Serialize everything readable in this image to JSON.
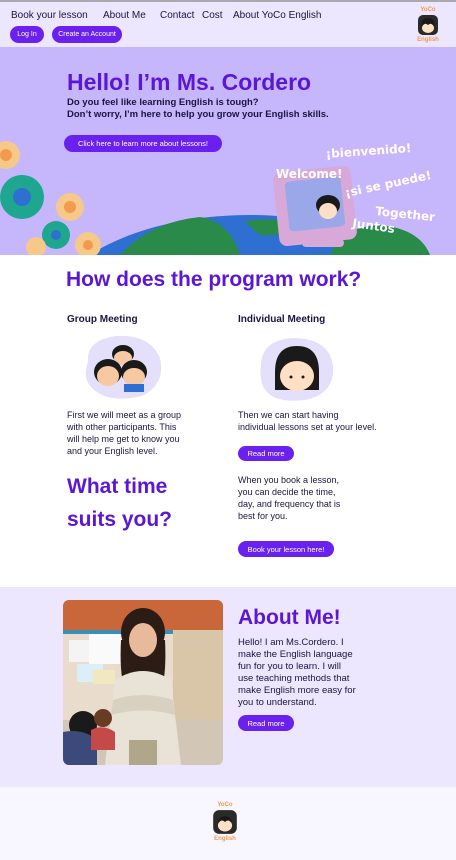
{
  "nav": {
    "links": [
      "Book your lesson",
      "About Me",
      "Contact",
      "Cost",
      "About YoCo English"
    ],
    "login_label": "Log In",
    "create_account_label": "Create an Account"
  },
  "logo": {
    "top": "YoCo",
    "bottom": "English"
  },
  "hero": {
    "title": "Hello! I’m Ms. Cordero",
    "subtitle_line1": "Do you feel like learning English is tough?",
    "subtitle_line2": "Don’t worry, I’m here to help you grow your English skills.",
    "cta_label": "Click here to learn more about lessons!",
    "bubbles": [
      "¡bienvenido!",
      "Welcome!",
      "¡si se puede!",
      "Together",
      "Juntos"
    ]
  },
  "program": {
    "title": "How does the program work?",
    "group": {
      "heading": "Group Meeting",
      "text": [
        "First we will meet as a group",
        "with other participants. This",
        "will help me get to know you",
        "and your English level."
      ]
    },
    "individual": {
      "heading": "Individual Meeting",
      "text": [
        "Then we can start having",
        "individual lessons set at your level."
      ],
      "read_more_label": "Read more"
    }
  },
  "time": {
    "title_line1": "What time",
    "title_line2": "suits you?",
    "text": [
      "When you book a lesson,",
      "you can decide the time,",
      "day, and frequency that is",
      "best for you."
    ],
    "book_label": "Book your lesson here!"
  },
  "about": {
    "title": "About Me!",
    "text": [
      "Hello! I am Ms.Cordero. I",
      "make the English language",
      "fun for you to learn. I will",
      "use teaching methods that",
      "make English more easy for",
      "you to understand."
    ],
    "read_more_label": "Read more"
  },
  "colors": {
    "primary": "#6a21f0",
    "title": "#5b16d6",
    "hero_bg": "#c6b6fb",
    "nav_bg": "#ece6ff",
    "logo_accent": "#f39b4c"
  }
}
